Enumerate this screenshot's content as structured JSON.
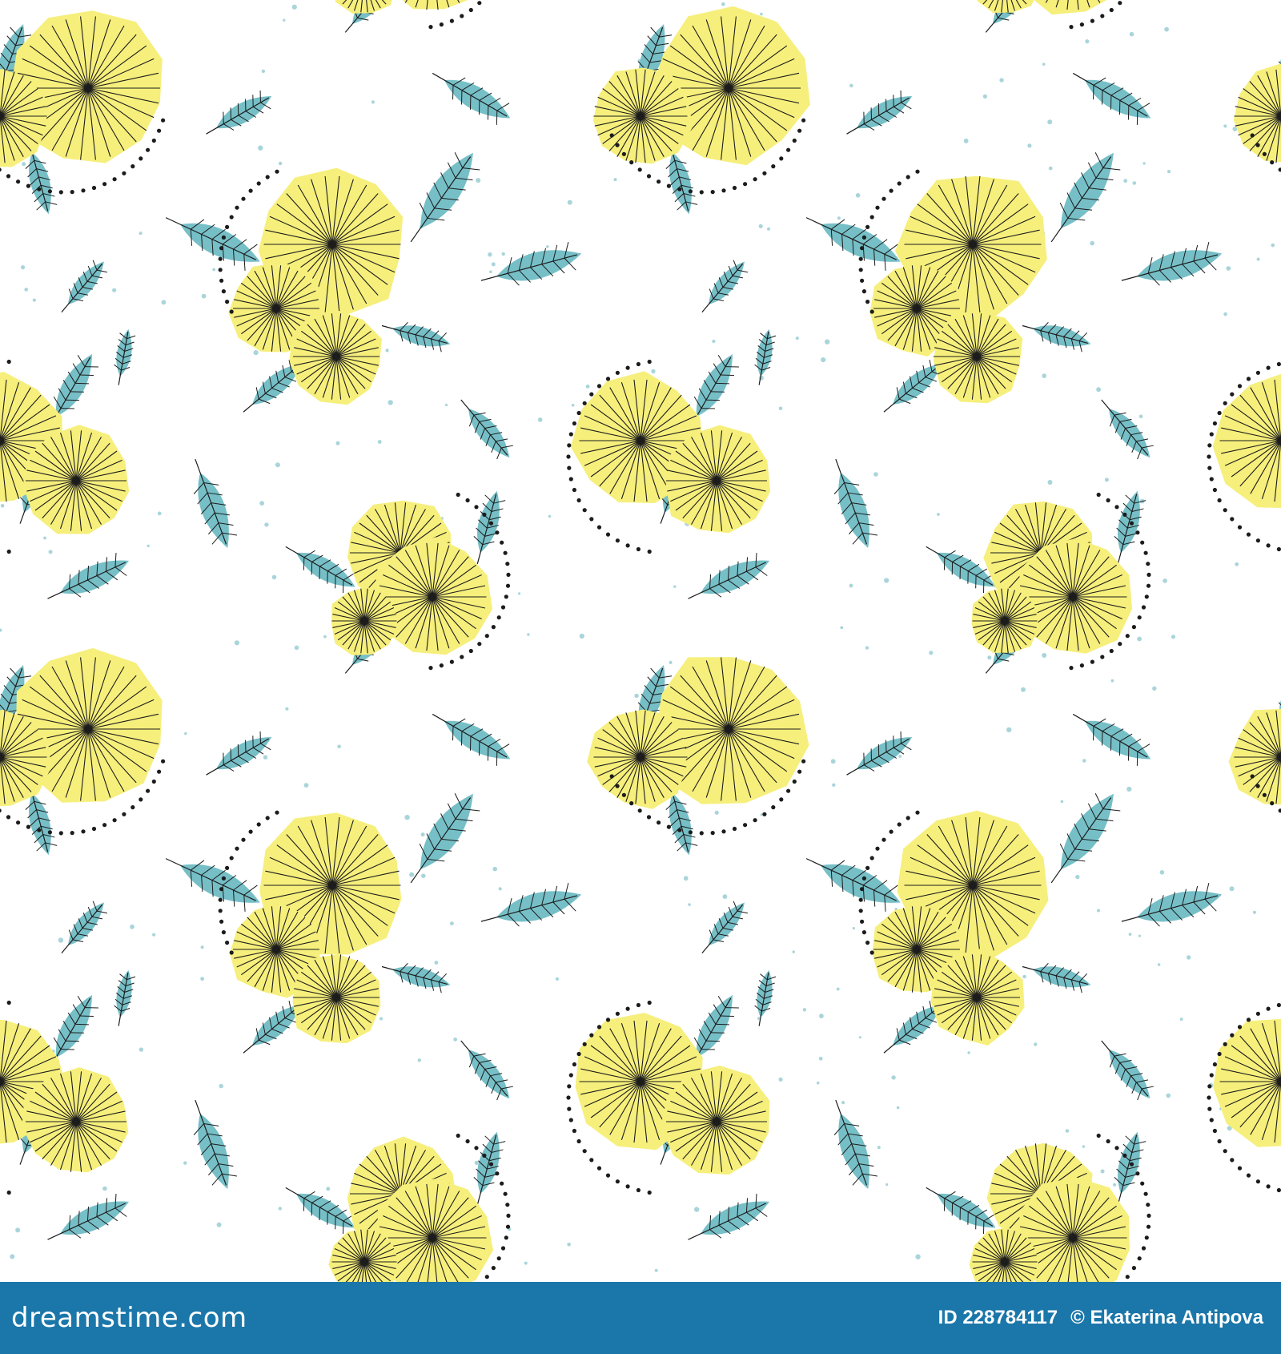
{
  "image": {
    "description_colors": {
      "background": "#ffffff",
      "flower_fill": "#f6ef7c",
      "leaf_fill": "#76bfc7",
      "line": "#1c1c1c",
      "speckle": "#a9d5da"
    },
    "motif_icons": [
      "yellow-flower-icon",
      "blue-leaf-icon",
      "dotted-outline"
    ]
  },
  "footer": {
    "logo": "dreamstime.com",
    "id_label": "ID 228784117",
    "author": "© Ekaterina Antipova",
    "bar_color": "#1b77a9"
  }
}
